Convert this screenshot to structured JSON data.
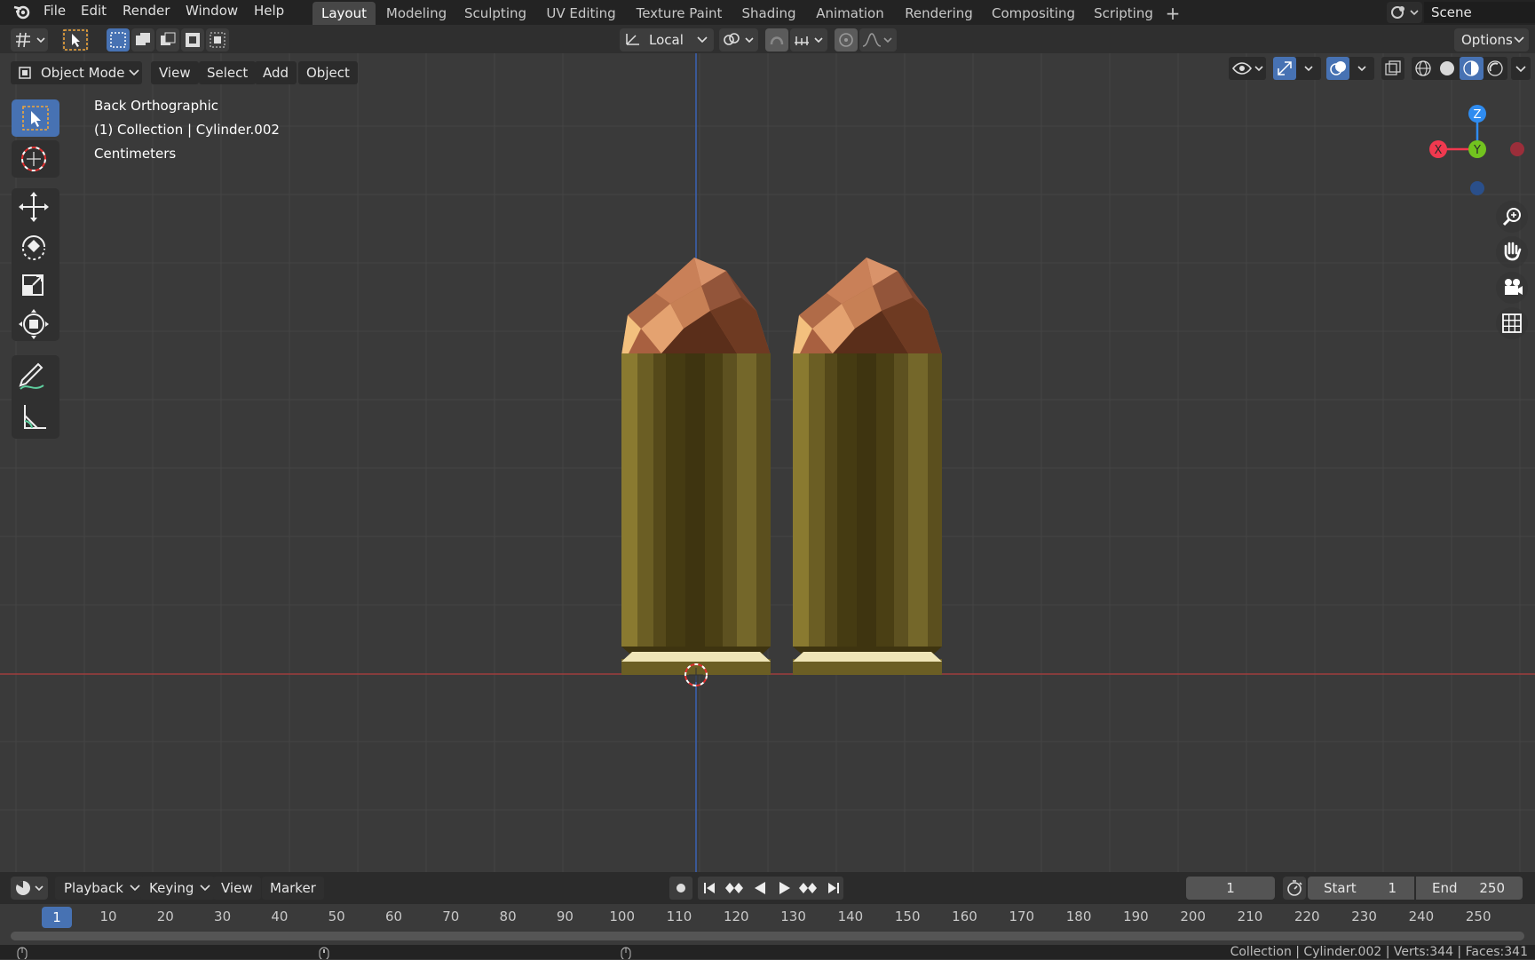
{
  "menu": [
    "File",
    "Edit",
    "Render",
    "Window",
    "Help"
  ],
  "workspace_tabs": [
    "Layout",
    "Modeling",
    "Sculpting",
    "UV Editing",
    "Texture Paint",
    "Shading",
    "Animation",
    "Rendering",
    "Compositing",
    "Scripting"
  ],
  "active_tab": "Layout",
  "scene_name": "Scene",
  "header": {
    "transform_orientation": "Local",
    "options_label": "Options"
  },
  "viewport_header": {
    "mode": "Object Mode",
    "menus": [
      "View",
      "Select",
      "Add",
      "Object"
    ]
  },
  "viewport_info": {
    "view_name": "Back Orthographic",
    "collection_line": "(1) Collection | Cylinder.002",
    "units": "Centimeters"
  },
  "gizmo": {
    "z": "Z",
    "y": "Y",
    "x": "X"
  },
  "timeline_header": {
    "menus": [
      "Playback",
      "Keying",
      "View",
      "Marker"
    ],
    "current_frame": "1",
    "start_label": "Start",
    "start_value": "1",
    "end_label": "End",
    "end_value": "250"
  },
  "timeline_ruler": {
    "current": "1",
    "ticks": [
      "10",
      "20",
      "30",
      "40",
      "50",
      "60",
      "70",
      "80",
      "90",
      "100",
      "110",
      "120",
      "130",
      "140",
      "150",
      "160",
      "170",
      "180",
      "190",
      "200",
      "210",
      "220",
      "230",
      "240",
      "250"
    ]
  },
  "status_bar": "Collection | Cylinder.002 | Verts:344 | Faces:341",
  "colors": {
    "accent_blue": "#4772b3",
    "axis_x": "#f0394f",
    "axis_y": "#72c31f",
    "axis_z": "#2f8cf0",
    "brass": "#6b5e24",
    "copper": "#b8714a"
  }
}
